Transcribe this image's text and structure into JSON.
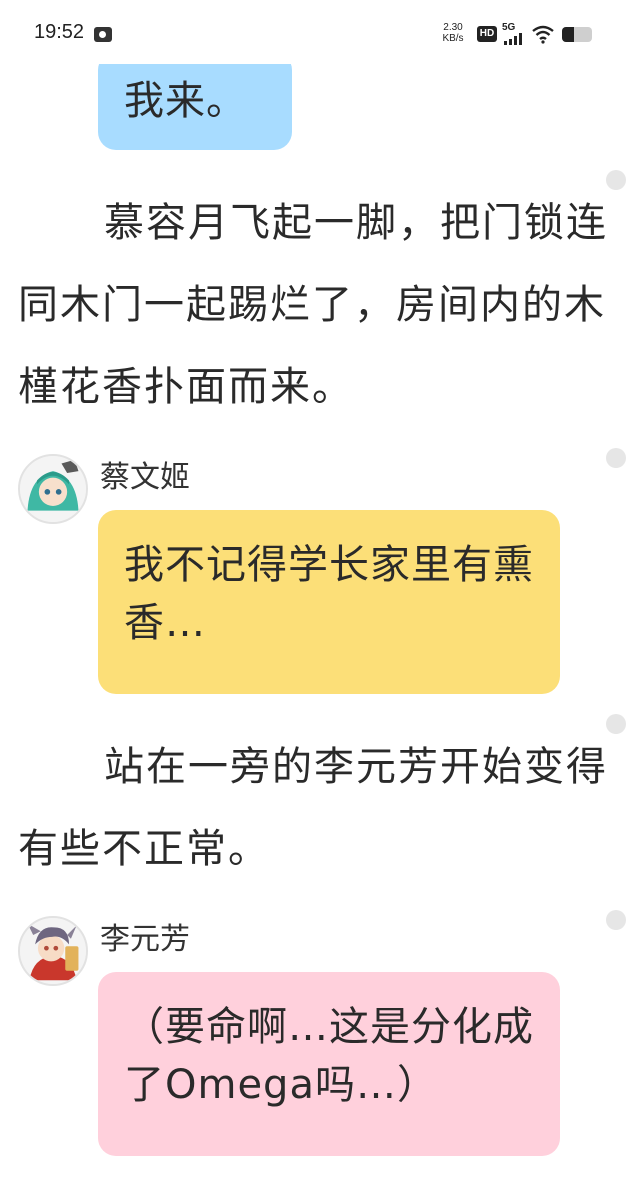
{
  "status_bar": {
    "time": "19:52",
    "net_speed_value": "2.30",
    "net_speed_unit": "KB/s",
    "hd_label": "HD",
    "network_label": "5G",
    "battery_level": 0.4
  },
  "messages": {
    "bubble_1": "我来。",
    "narration_1": "慕容月飞起一脚，把门锁连同木门一起踢烂了，房间内的木槿花香扑面而来。",
    "speaker_2": "蔡文姬",
    "bubble_2": "我不记得学长家里有熏香…",
    "narration_2": "站在一旁的李元芳开始变得有些不正常。",
    "speaker_3": "李元芳",
    "bubble_3": "（要命啊…这是分化成了Omega吗…）"
  },
  "colors": {
    "bubble_blue": "#a8dcff",
    "bubble_yellow": "#fcdf78",
    "bubble_pink": "#ffd0dc"
  }
}
